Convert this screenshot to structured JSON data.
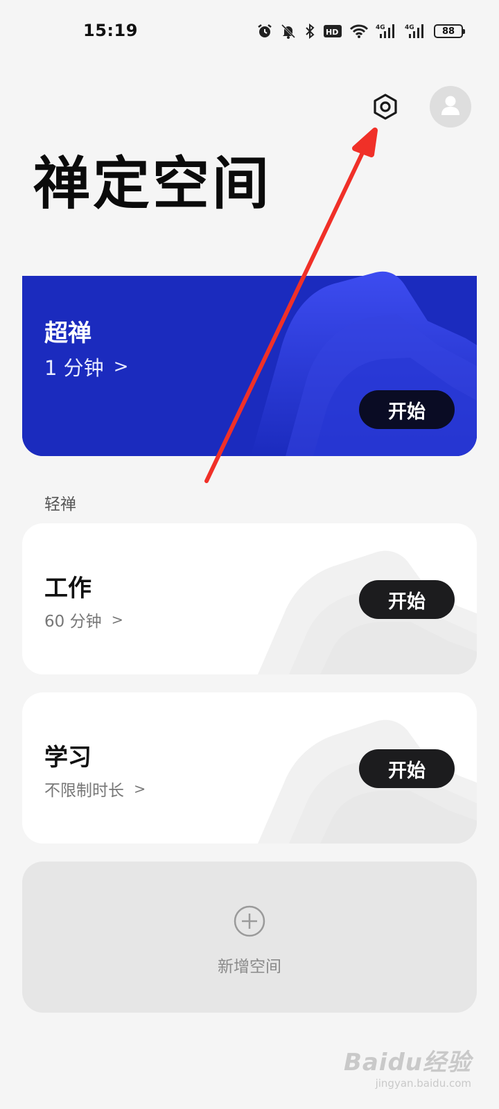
{
  "status_bar": {
    "time": "15:19",
    "battery": "88",
    "icons": [
      "alarm-icon",
      "mute-bell-icon",
      "bluetooth-icon",
      "hd-icon",
      "wifi-icon",
      "signal-4g-icon",
      "signal-4g-icon",
      "battery-icon"
    ]
  },
  "header": {
    "settings_icon": "settings-hex-icon",
    "avatar_icon": "user-icon",
    "title": "禅定空间"
  },
  "featured": {
    "title": "超禅",
    "duration": "1 分钟",
    "chevron": ">",
    "start_label": "开始",
    "color": "#1b2bbe"
  },
  "section": {
    "label": "轻禅"
  },
  "spaces": [
    {
      "title": "工作",
      "duration": "60 分钟",
      "chevron": ">",
      "start_label": "开始"
    },
    {
      "title": "学习",
      "duration": "不限制时长",
      "chevron": ">",
      "start_label": "开始"
    }
  ],
  "add_space": {
    "icon": "plus-circle-icon",
    "label": "新增空间"
  },
  "annotation": {
    "color": "#f03028"
  },
  "watermark": {
    "main": "Baidu经验",
    "sub": "jingyan.baidu.com"
  }
}
